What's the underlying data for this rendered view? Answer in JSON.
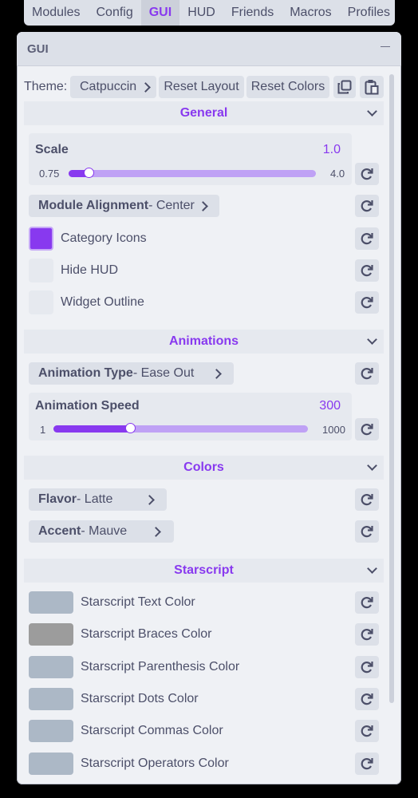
{
  "top_tabs": [
    "Modules",
    "Config",
    "GUI",
    "HUD",
    "Friends",
    "Macros",
    "Profiles"
  ],
  "active_tab": "GUI",
  "window": {
    "title": "GUI"
  },
  "theme": {
    "label": "Theme:",
    "value": "Catpuccin",
    "reset_layout": "Reset Layout",
    "reset_colors": "Reset Colors"
  },
  "general": {
    "header": "General",
    "scale": {
      "name": "Scale",
      "value": "1.0",
      "min": "0.75",
      "max": "4.0",
      "level": 0.08
    },
    "module_alignment": {
      "name": "Module Alignment",
      "value": " - Center"
    },
    "category_icons": {
      "label": "Category Icons",
      "checked": true
    },
    "hide_hud": {
      "label": "Hide HUD",
      "checked": false
    },
    "widget_outline": {
      "label": "Widget Outline",
      "checked": false
    }
  },
  "animations": {
    "header": "Animations",
    "animation_type": {
      "name": "Animation Type",
      "value": " - Ease Out"
    },
    "animation_speed": {
      "name": "Animation Speed",
      "value": "300",
      "min": "1",
      "max": "1000",
      "level": 0.3
    }
  },
  "colors": {
    "header": "Colors",
    "flavor": {
      "name": "Flavor",
      "value": " - Latte"
    },
    "accent": {
      "name": "Accent",
      "value": " - Mauve"
    }
  },
  "starscript": {
    "header": "Starscript",
    "items": [
      {
        "label": "Starscript Text Color",
        "color": "#acb8c6"
      },
      {
        "label": "Starscript Braces Color",
        "color": "#9c9c9c"
      },
      {
        "label": "Starscript Parenthesis Color",
        "color": "#acb8c6"
      },
      {
        "label": "Starscript Dots Color",
        "color": "#acb8c6"
      },
      {
        "label": "Starscript Commas Color",
        "color": "#acb8c6"
      },
      {
        "label": "Starscript Operators Color",
        "color": "#acb8c6"
      }
    ]
  },
  "colors_palette": {
    "accent": "#8839ef",
    "base": "#eff1f5",
    "mantle": "#e6e9ef",
    "crust": "#dce0e8",
    "text": "#4c4f69"
  }
}
